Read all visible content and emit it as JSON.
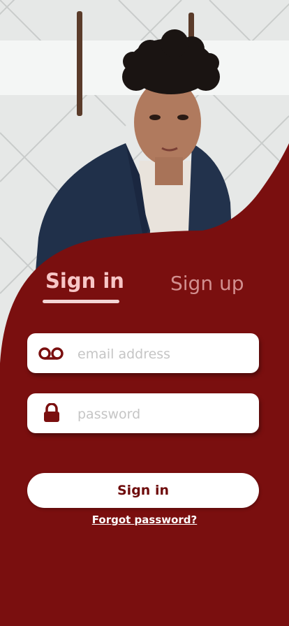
{
  "tabs": {
    "signin_label": "Sign in",
    "signup_label": "Sign up",
    "active": "signin"
  },
  "email": {
    "placeholder": "email address",
    "icon": "voicemail-icon"
  },
  "password": {
    "placeholder": "password",
    "icon": "lock-icon"
  },
  "actions": {
    "signin_label": "Sign in",
    "forgot_label": "Forgot password?"
  },
  "colors": {
    "brand": "#7a0f0f",
    "active_tab": "#f7c6c6",
    "inactive_tab": "#d28f8f"
  }
}
